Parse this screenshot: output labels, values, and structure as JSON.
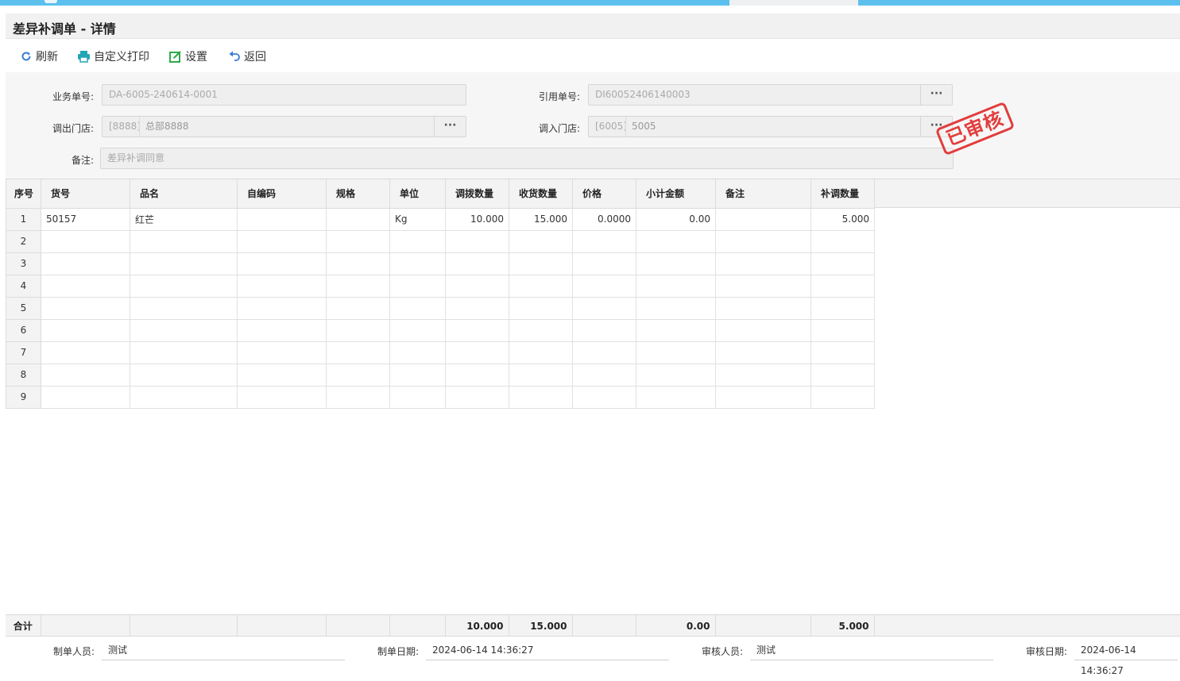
{
  "page": {
    "title": "差异补调单 - 详情"
  },
  "toolbar": {
    "refresh": "刷新",
    "custom_print": "自定义打印",
    "settings": "设置",
    "back": "返回"
  },
  "form": {
    "biz_no": {
      "label": "业务单号:",
      "value": "DA-6005-240614-0001"
    },
    "ref_no": {
      "label": "引用单号:",
      "value": "DI60052406140003"
    },
    "out_store": {
      "label": "调出门店:",
      "code": "[8888]",
      "name": "总部8888"
    },
    "in_store": {
      "label": "调入门店:",
      "code": "[6005]",
      "name": "5005"
    },
    "remark": {
      "label": "备注:",
      "value": "差异补调同意"
    },
    "more": "···"
  },
  "stamp": "已审核",
  "grid": {
    "columns": [
      "序号",
      "货号",
      "品名",
      "自编码",
      "规格",
      "单位",
      "调拨数量",
      "收货数量",
      "价格",
      "小计金额",
      "备注",
      "补调数量"
    ],
    "rows": [
      {
        "seq": "1",
        "sku": "50157",
        "name": "红芒",
        "code": "",
        "spec": "",
        "unit": "Kg",
        "transfer_qty": "10.000",
        "recv_qty": "15.000",
        "price": "0.0000",
        "subtotal": "0.00",
        "note": "",
        "adj_qty": "5.000"
      },
      {
        "seq": "2",
        "sku": "",
        "name": "",
        "code": "",
        "spec": "",
        "unit": "",
        "transfer_qty": "",
        "recv_qty": "",
        "price": "",
        "subtotal": "",
        "note": "",
        "adj_qty": ""
      },
      {
        "seq": "3",
        "sku": "",
        "name": "",
        "code": "",
        "spec": "",
        "unit": "",
        "transfer_qty": "",
        "recv_qty": "",
        "price": "",
        "subtotal": "",
        "note": "",
        "adj_qty": ""
      },
      {
        "seq": "4",
        "sku": "",
        "name": "",
        "code": "",
        "spec": "",
        "unit": "",
        "transfer_qty": "",
        "recv_qty": "",
        "price": "",
        "subtotal": "",
        "note": "",
        "adj_qty": ""
      },
      {
        "seq": "5",
        "sku": "",
        "name": "",
        "code": "",
        "spec": "",
        "unit": "",
        "transfer_qty": "",
        "recv_qty": "",
        "price": "",
        "subtotal": "",
        "note": "",
        "adj_qty": ""
      },
      {
        "seq": "6",
        "sku": "",
        "name": "",
        "code": "",
        "spec": "",
        "unit": "",
        "transfer_qty": "",
        "recv_qty": "",
        "price": "",
        "subtotal": "",
        "note": "",
        "adj_qty": ""
      },
      {
        "seq": "7",
        "sku": "",
        "name": "",
        "code": "",
        "spec": "",
        "unit": "",
        "transfer_qty": "",
        "recv_qty": "",
        "price": "",
        "subtotal": "",
        "note": "",
        "adj_qty": ""
      },
      {
        "seq": "8",
        "sku": "",
        "name": "",
        "code": "",
        "spec": "",
        "unit": "",
        "transfer_qty": "",
        "recv_qty": "",
        "price": "",
        "subtotal": "",
        "note": "",
        "adj_qty": ""
      },
      {
        "seq": "9",
        "sku": "",
        "name": "",
        "code": "",
        "spec": "",
        "unit": "",
        "transfer_qty": "",
        "recv_qty": "",
        "price": "",
        "subtotal": "",
        "note": "",
        "adj_qty": ""
      }
    ]
  },
  "totals": {
    "label": "合计",
    "transfer_qty": "10.000",
    "recv_qty": "15.000",
    "subtotal": "0.00",
    "adj_qty": "5.000"
  },
  "footer": {
    "creator": {
      "label": "制单人员:",
      "value": "测试"
    },
    "create_date": {
      "label": "制单日期:",
      "value": "2024-06-14 14:36:27"
    },
    "auditor": {
      "label": "审核人员:",
      "value": "测试"
    },
    "audit_date": {
      "label": "审核日期:",
      "value": "2024-06-14 14:36:27"
    }
  },
  "colors": {
    "accent": "#5cc0ef",
    "stamp": "#e23d3d",
    "icon_blue": "#3a7bd5",
    "icon_teal": "#23a6b5",
    "icon_green": "#2faa4a"
  }
}
